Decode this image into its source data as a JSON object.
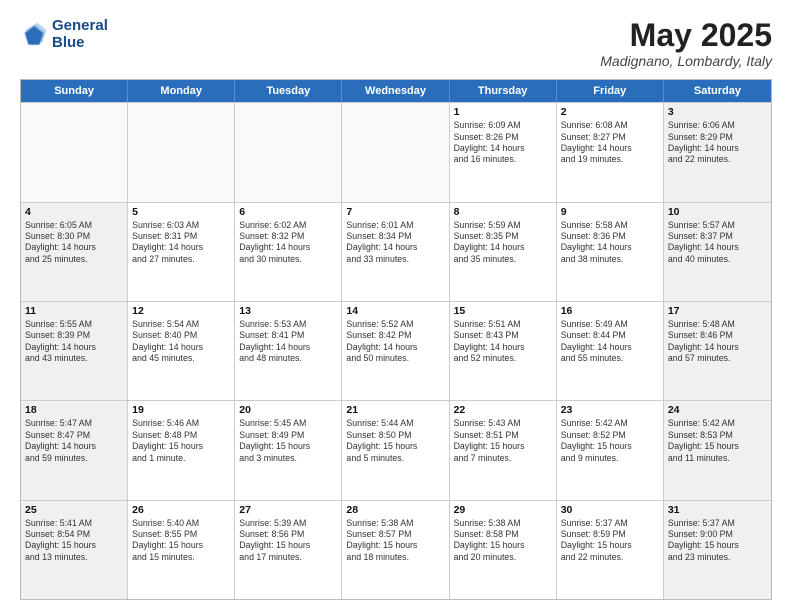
{
  "header": {
    "logo_line1": "General",
    "logo_line2": "Blue",
    "month": "May 2025",
    "location": "Madignano, Lombardy, Italy"
  },
  "days_of_week": [
    "Sunday",
    "Monday",
    "Tuesday",
    "Wednesday",
    "Thursday",
    "Friday",
    "Saturday"
  ],
  "weeks": [
    [
      {
        "day": "",
        "text": "",
        "empty": true
      },
      {
        "day": "",
        "text": "",
        "empty": true
      },
      {
        "day": "",
        "text": "",
        "empty": true
      },
      {
        "day": "",
        "text": "",
        "empty": true
      },
      {
        "day": "1",
        "text": "Sunrise: 6:09 AM\nSunset: 8:26 PM\nDaylight: 14 hours\nand 16 minutes.",
        "empty": false,
        "weekend": false
      },
      {
        "day": "2",
        "text": "Sunrise: 6:08 AM\nSunset: 8:27 PM\nDaylight: 14 hours\nand 19 minutes.",
        "empty": false,
        "weekend": false
      },
      {
        "day": "3",
        "text": "Sunrise: 6:06 AM\nSunset: 8:29 PM\nDaylight: 14 hours\nand 22 minutes.",
        "empty": false,
        "weekend": true
      }
    ],
    [
      {
        "day": "4",
        "text": "Sunrise: 6:05 AM\nSunset: 8:30 PM\nDaylight: 14 hours\nand 25 minutes.",
        "empty": false,
        "weekend": true
      },
      {
        "day": "5",
        "text": "Sunrise: 6:03 AM\nSunset: 8:31 PM\nDaylight: 14 hours\nand 27 minutes.",
        "empty": false,
        "weekend": false
      },
      {
        "day": "6",
        "text": "Sunrise: 6:02 AM\nSunset: 8:32 PM\nDaylight: 14 hours\nand 30 minutes.",
        "empty": false,
        "weekend": false
      },
      {
        "day": "7",
        "text": "Sunrise: 6:01 AM\nSunset: 8:34 PM\nDaylight: 14 hours\nand 33 minutes.",
        "empty": false,
        "weekend": false
      },
      {
        "day": "8",
        "text": "Sunrise: 5:59 AM\nSunset: 8:35 PM\nDaylight: 14 hours\nand 35 minutes.",
        "empty": false,
        "weekend": false
      },
      {
        "day": "9",
        "text": "Sunrise: 5:58 AM\nSunset: 8:36 PM\nDaylight: 14 hours\nand 38 minutes.",
        "empty": false,
        "weekend": false
      },
      {
        "day": "10",
        "text": "Sunrise: 5:57 AM\nSunset: 8:37 PM\nDaylight: 14 hours\nand 40 minutes.",
        "empty": false,
        "weekend": true
      }
    ],
    [
      {
        "day": "11",
        "text": "Sunrise: 5:55 AM\nSunset: 8:39 PM\nDaylight: 14 hours\nand 43 minutes.",
        "empty": false,
        "weekend": true
      },
      {
        "day": "12",
        "text": "Sunrise: 5:54 AM\nSunset: 8:40 PM\nDaylight: 14 hours\nand 45 minutes.",
        "empty": false,
        "weekend": false
      },
      {
        "day": "13",
        "text": "Sunrise: 5:53 AM\nSunset: 8:41 PM\nDaylight: 14 hours\nand 48 minutes.",
        "empty": false,
        "weekend": false
      },
      {
        "day": "14",
        "text": "Sunrise: 5:52 AM\nSunset: 8:42 PM\nDaylight: 14 hours\nand 50 minutes.",
        "empty": false,
        "weekend": false
      },
      {
        "day": "15",
        "text": "Sunrise: 5:51 AM\nSunset: 8:43 PM\nDaylight: 14 hours\nand 52 minutes.",
        "empty": false,
        "weekend": false
      },
      {
        "day": "16",
        "text": "Sunrise: 5:49 AM\nSunset: 8:44 PM\nDaylight: 14 hours\nand 55 minutes.",
        "empty": false,
        "weekend": false
      },
      {
        "day": "17",
        "text": "Sunrise: 5:48 AM\nSunset: 8:46 PM\nDaylight: 14 hours\nand 57 minutes.",
        "empty": false,
        "weekend": true
      }
    ],
    [
      {
        "day": "18",
        "text": "Sunrise: 5:47 AM\nSunset: 8:47 PM\nDaylight: 14 hours\nand 59 minutes.",
        "empty": false,
        "weekend": true
      },
      {
        "day": "19",
        "text": "Sunrise: 5:46 AM\nSunset: 8:48 PM\nDaylight: 15 hours\nand 1 minute.",
        "empty": false,
        "weekend": false
      },
      {
        "day": "20",
        "text": "Sunrise: 5:45 AM\nSunset: 8:49 PM\nDaylight: 15 hours\nand 3 minutes.",
        "empty": false,
        "weekend": false
      },
      {
        "day": "21",
        "text": "Sunrise: 5:44 AM\nSunset: 8:50 PM\nDaylight: 15 hours\nand 5 minutes.",
        "empty": false,
        "weekend": false
      },
      {
        "day": "22",
        "text": "Sunrise: 5:43 AM\nSunset: 8:51 PM\nDaylight: 15 hours\nand 7 minutes.",
        "empty": false,
        "weekend": false
      },
      {
        "day": "23",
        "text": "Sunrise: 5:42 AM\nSunset: 8:52 PM\nDaylight: 15 hours\nand 9 minutes.",
        "empty": false,
        "weekend": false
      },
      {
        "day": "24",
        "text": "Sunrise: 5:42 AM\nSunset: 8:53 PM\nDaylight: 15 hours\nand 11 minutes.",
        "empty": false,
        "weekend": true
      }
    ],
    [
      {
        "day": "25",
        "text": "Sunrise: 5:41 AM\nSunset: 8:54 PM\nDaylight: 15 hours\nand 13 minutes.",
        "empty": false,
        "weekend": true
      },
      {
        "day": "26",
        "text": "Sunrise: 5:40 AM\nSunset: 8:55 PM\nDaylight: 15 hours\nand 15 minutes.",
        "empty": false,
        "weekend": false
      },
      {
        "day": "27",
        "text": "Sunrise: 5:39 AM\nSunset: 8:56 PM\nDaylight: 15 hours\nand 17 minutes.",
        "empty": false,
        "weekend": false
      },
      {
        "day": "28",
        "text": "Sunrise: 5:38 AM\nSunset: 8:57 PM\nDaylight: 15 hours\nand 18 minutes.",
        "empty": false,
        "weekend": false
      },
      {
        "day": "29",
        "text": "Sunrise: 5:38 AM\nSunset: 8:58 PM\nDaylight: 15 hours\nand 20 minutes.",
        "empty": false,
        "weekend": false
      },
      {
        "day": "30",
        "text": "Sunrise: 5:37 AM\nSunset: 8:59 PM\nDaylight: 15 hours\nand 22 minutes.",
        "empty": false,
        "weekend": false
      },
      {
        "day": "31",
        "text": "Sunrise: 5:37 AM\nSunset: 9:00 PM\nDaylight: 15 hours\nand 23 minutes.",
        "empty": false,
        "weekend": true
      }
    ]
  ]
}
